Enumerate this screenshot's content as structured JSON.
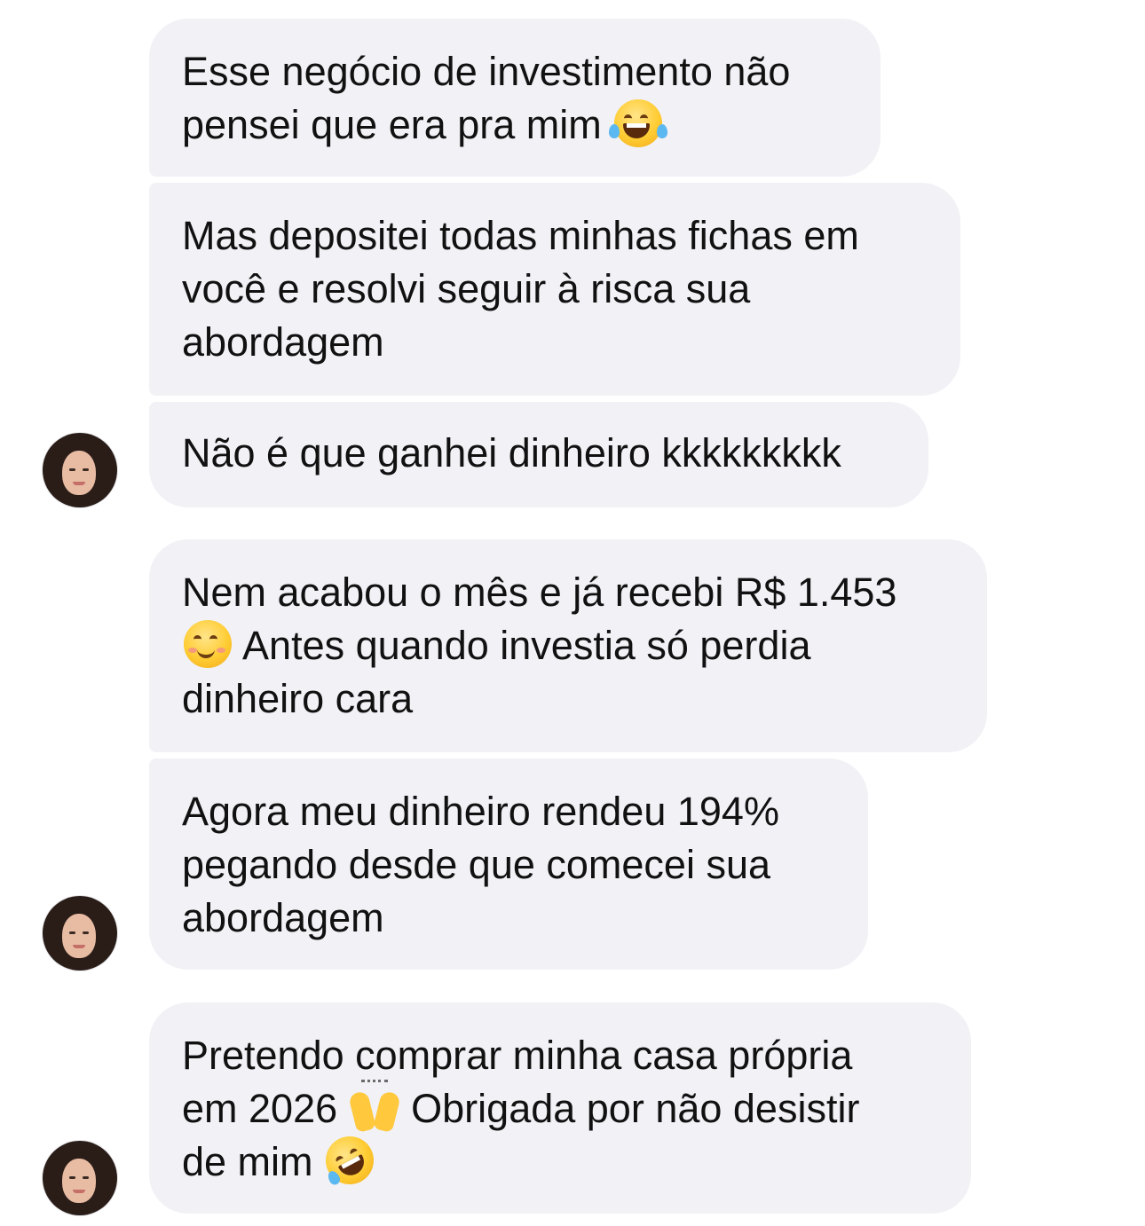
{
  "messages": [
    {
      "lines": [
        "Esse negócio de investimento não",
        "pensei que era pra mim"
      ],
      "trailing_emoji": "face-with-tears-of-joy-icon"
    },
    {
      "lines": [
        "Mas depositei todas minhas fichas em",
        "você e resolvi seguir à risca sua",
        "abordagem"
      ]
    },
    {
      "lines": [
        "Não é que ganhei dinheiro kkkkkkkkk"
      ]
    },
    {
      "lines": [
        "Nem acabou o mês e já recebi R$ 1.453",
        "Antes quando investia só perdia",
        "dinheiro cara"
      ],
      "emoji": "smiling-face-icon"
    },
    {
      "lines": [
        "Agora meu dinheiro rendeu 194%",
        "pegando desde que comecei sua",
        "abordagem"
      ]
    },
    {
      "lines": [
        "Pretendo comprar minha casa própria",
        "em 2026",
        "Obrigada por não desistir",
        "de mim"
      ],
      "emojis": [
        "raising-hands-icon",
        "rolling-on-the-floor-laughing-icon"
      ]
    }
  ]
}
